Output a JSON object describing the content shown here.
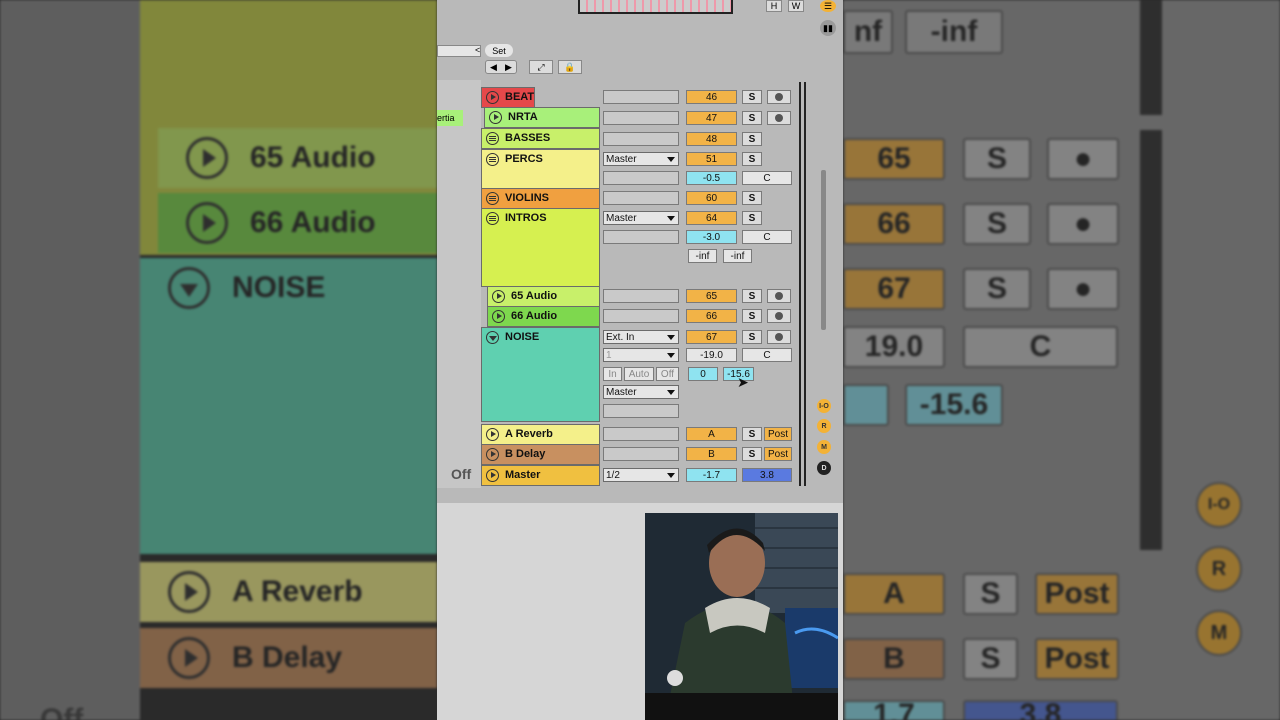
{
  "background": {
    "rows": [
      {
        "label": "65 Audio",
        "num": "65"
      },
      {
        "label": "66 Audio",
        "num": "66"
      },
      {
        "label": "NOISE",
        "num": "67"
      },
      {
        "label": "A Reverb",
        "num": "A"
      },
      {
        "label": "B Delay",
        "num": "B"
      }
    ],
    "values": {
      "inf1": "nf",
      "inf2": "-inf",
      "v19": "19.0",
      "c": "C",
      "v156": "-15.6",
      "s": "S",
      "post": "Post",
      "off": "Off",
      "v17": "1.7",
      "v38": "3.8",
      "io": "I-O",
      "r": "R",
      "m": "M"
    }
  },
  "toolbar": {
    "set_label": "Set",
    "h": "H",
    "w": "W",
    "inertia": "ertia"
  },
  "tracks": [
    {
      "name": "BEAT",
      "color": "#e5484a",
      "num": "46",
      "s": "S",
      "rec": true,
      "icon": "play"
    },
    {
      "name": "NRTA",
      "color": "#a8f07a",
      "num": "47",
      "s": "S",
      "rec": true,
      "icon": "play"
    },
    {
      "name": "BASSES",
      "color": "#c8f06a",
      "num": "48",
      "s": "S",
      "rec": false,
      "icon": "group"
    },
    {
      "name": "PERCS",
      "color": "#f4f08a",
      "num": "51",
      "s": "S",
      "rec": false,
      "icon": "group",
      "route": "Master",
      "vol": "-0.5",
      "pan": "C"
    },
    {
      "name": "VIOLINS",
      "color": "#f0a040",
      "num": "60",
      "s": "S",
      "rec": false,
      "icon": "group"
    },
    {
      "name": "INTROS",
      "color": "#d6f050",
      "num": "64",
      "s": "S",
      "rec": false,
      "icon": "group",
      "route": "Master",
      "vol": "-3.0",
      "pan": "C",
      "inf1": "-inf",
      "inf2": "-inf"
    },
    {
      "name": "65 Audio",
      "color": "#c8f06a",
      "num": "65",
      "s": "S",
      "rec": true,
      "icon": "play"
    },
    {
      "name": "66 Audio",
      "color": "#7ed84e",
      "num": "66",
      "s": "S",
      "rec": true,
      "icon": "play"
    },
    {
      "name": "NOISE",
      "color": "#5fd0b0",
      "num": "67",
      "s": "S",
      "rec": true,
      "icon": "fold",
      "route": "Ext. In",
      "chan": "1",
      "vol": "-19.0",
      "pan": "C",
      "in": "In",
      "auto": "Auto",
      "off": "Off",
      "out": "Master",
      "send1": "0",
      "send2": "-15.6"
    },
    {
      "name": "A Reverb",
      "color": "#f4f08a",
      "num": "A",
      "s": "S",
      "post": "Post",
      "icon": "play"
    },
    {
      "name": "B Delay",
      "color": "#c89060",
      "num": "B",
      "s": "S",
      "post": "Post",
      "icon": "play"
    },
    {
      "name": "Master",
      "color": "#f0c040",
      "route": "1/2",
      "vol": "-1.7",
      "pan": "3.8",
      "off": "Off",
      "icon": "play"
    }
  ],
  "right_buttons": [
    "I-O",
    "R",
    "M",
    "D"
  ]
}
